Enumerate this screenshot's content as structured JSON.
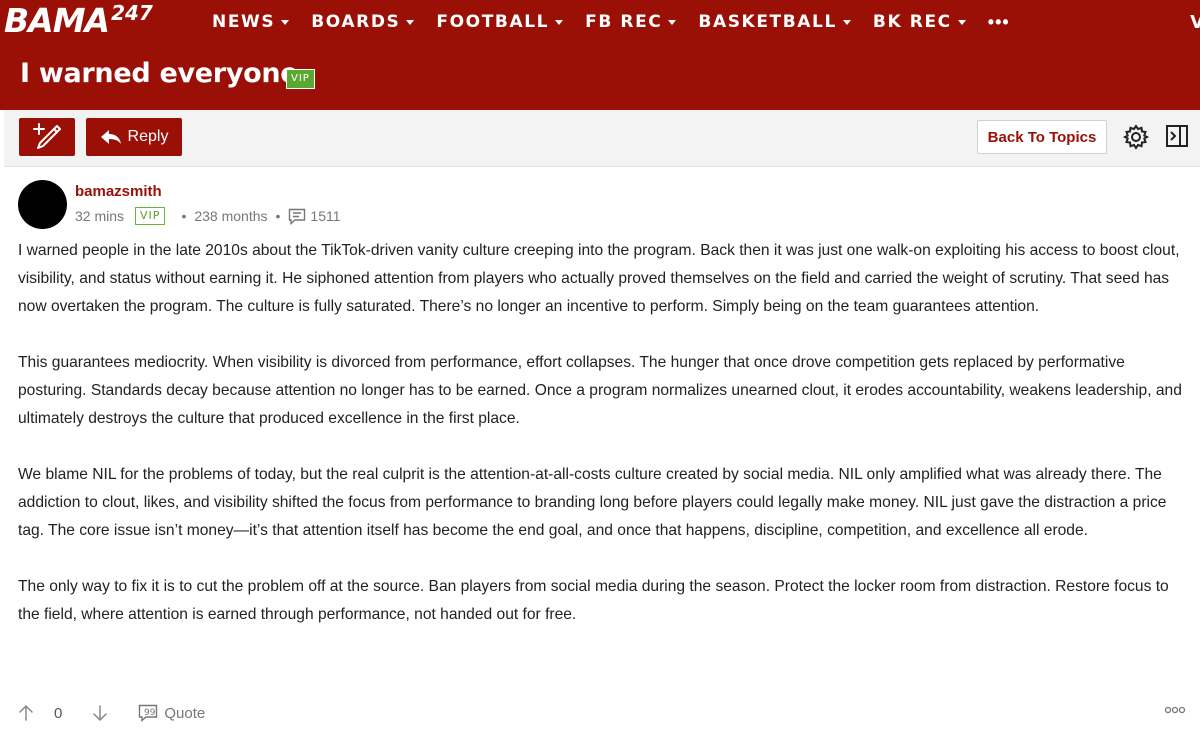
{
  "site": {
    "logo_text": "BAMA",
    "logo_sup": "247",
    "nav": [
      {
        "label": "NEWS"
      },
      {
        "label": "BOARDS"
      },
      {
        "label": "FOOTBALL"
      },
      {
        "label": "FB REC"
      },
      {
        "label": "BASKETBALL"
      },
      {
        "label": "BK REC"
      }
    ],
    "nav_more": "•••",
    "nav_edge": "V",
    "brand_color": "#9b1006"
  },
  "topic": {
    "title": "I warned everyone",
    "badge": "VIP"
  },
  "toolbar": {
    "new_post_icon": "compose-icon",
    "reply_label": "Reply",
    "back_label": "Back To Topics",
    "settings_icon": "gear-icon",
    "panel_icon": "panel-toggle-icon"
  },
  "post": {
    "username": "bamazsmith",
    "time": "32 mins",
    "badge": "VIP",
    "tenure": "238 months",
    "post_count": "1511",
    "paragraphs": [
      "I warned people in the late 2010s about the TikTok-driven vanity culture creeping into the program. Back then it was just one walk-on exploiting his access to boost clout, visibility, and status without earning it. He siphoned attention from players who actually proved themselves on the field and carried the weight of scrutiny. That seed has now overtaken the program. The culture is fully saturated. There’s no longer an incentive to perform. Simply being on the team guarantees attention.",
      "This guarantees mediocrity. When visibility is divorced from performance, effort collapses. The hunger that once drove competition gets replaced by performative posturing. Standards decay because attention no longer has to be earned. Once a program normalizes unearned clout, it erodes accountability, weakens leadership, and ultimately destroys the culture that produced excellence in the first place.",
      "We blame NIL for the problems of today, but the real culprit is the attention-at-all-costs culture created by social media. NIL only amplified what was already there. The addiction to clout, likes, and visibility shifted the focus from performance to branding long before players could legally make money. NIL just gave the distraction a price tag. The core issue isn’t money—it’s that attention itself has become the end goal, and once that happens, discipline, competition, and excellence all erode.",
      "The only way to fix it is to cut the problem off at the source. Ban players from social media during the season. Protect the locker room from distraction. Restore focus to the field, where attention is earned through performance, not handed out for free."
    ],
    "vote_count": "0",
    "quote_label": "Quote"
  }
}
